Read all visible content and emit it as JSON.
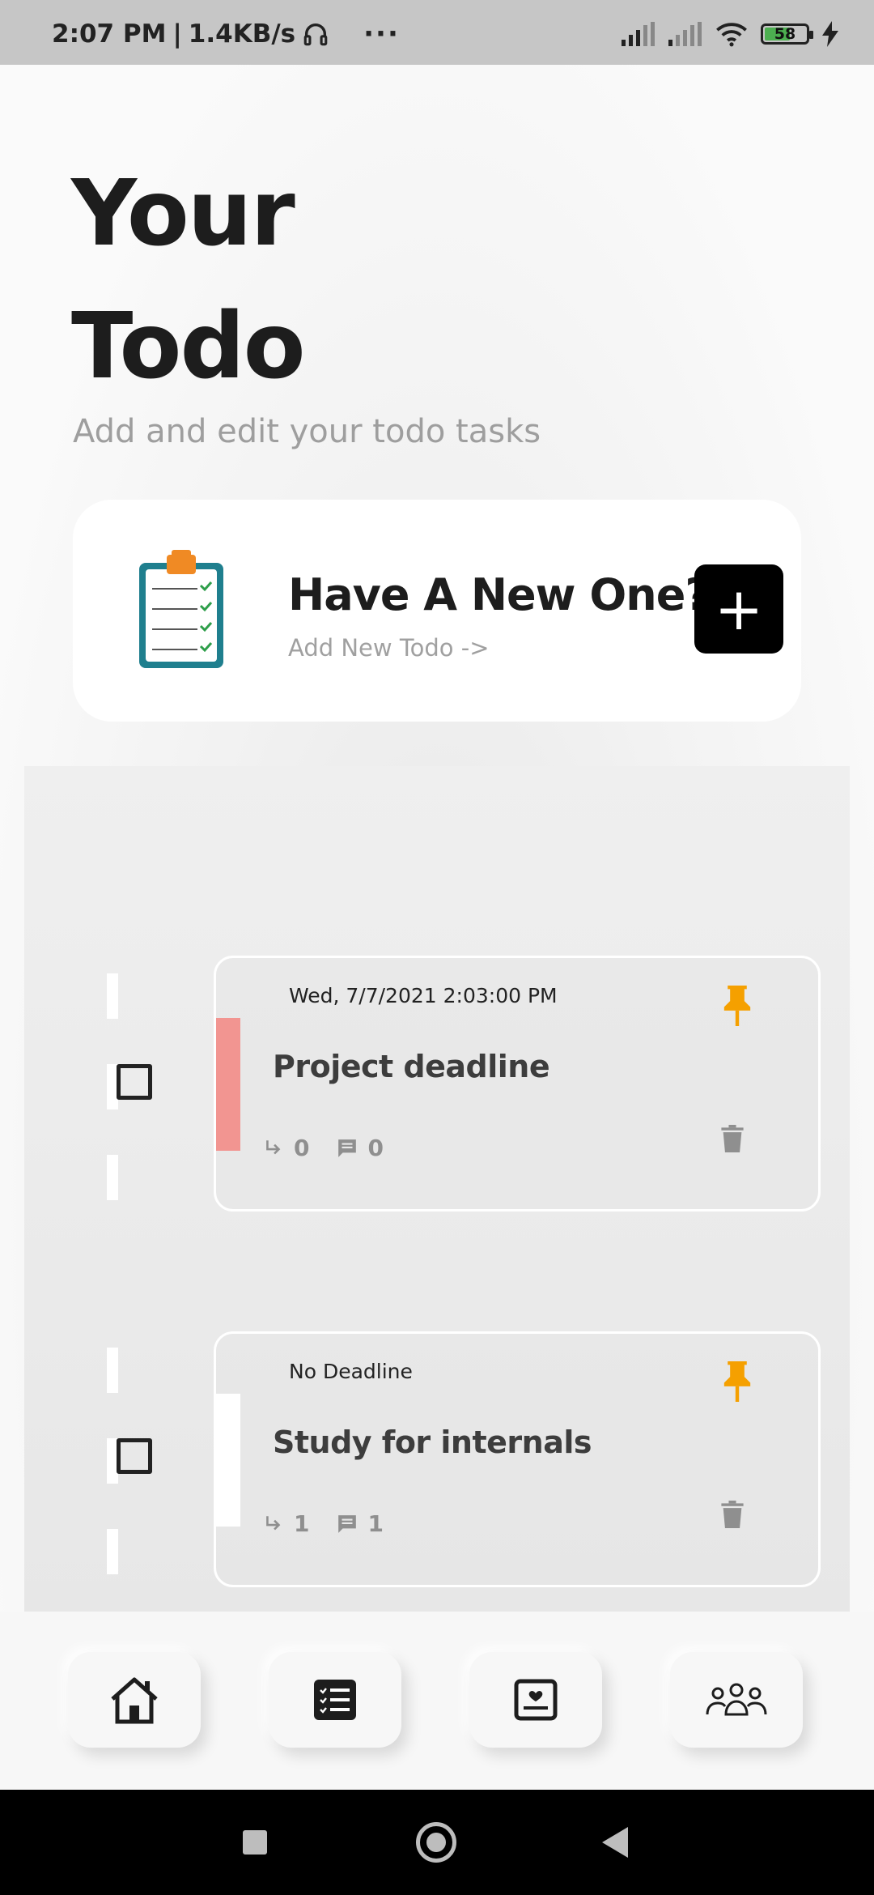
{
  "status_bar": {
    "time": "2:07 PM",
    "network_speed": "1.4KB/s",
    "separator": "|",
    "more": "···",
    "battery_percent": "58"
  },
  "header": {
    "title_line1": "Your",
    "title_line2": "Todo",
    "subtitle": "Add and edit your todo tasks"
  },
  "new_todo_card": {
    "headline": "Have A New One?",
    "link_text": "Add New Todo  ->",
    "add_button_label": "+",
    "icon": "clipboard-checklist-icon"
  },
  "todos": [
    {
      "date": "Wed, 7/7/2021 2:03:00 PM",
      "title": "Project deadline",
      "subtasks": "0",
      "comments": "0",
      "priority_color": "#f29591",
      "pinned": true,
      "checked": false
    },
    {
      "date": "No Deadline",
      "title": "Study for internals",
      "subtasks": "1",
      "comments": "1",
      "priority_color": "#ffffff",
      "pinned": true,
      "checked": false
    }
  ],
  "bottom_nav": [
    "home-icon",
    "checklist-icon",
    "notes-heart-icon",
    "people-icon"
  ],
  "colors": {
    "accent_pin": "#f5a000",
    "add_button": "#000000",
    "subtitle": "#9e9e9e"
  }
}
